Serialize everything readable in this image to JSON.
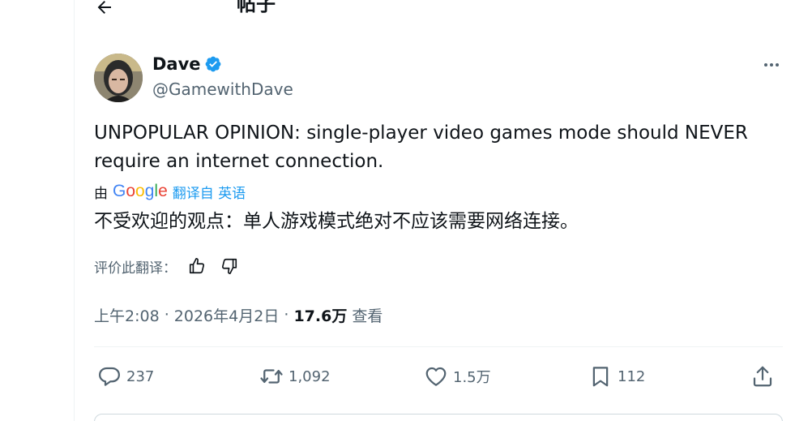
{
  "header": {
    "title": "帖子"
  },
  "author": {
    "display_name": "Dave",
    "handle": "@GamewithDave"
  },
  "tweet": {
    "text": "UNPOPULAR OPINION: single-player video games mode should NEVER require an internet connection.",
    "translated_by_label": "由",
    "google_letters": [
      "G",
      "o",
      "o",
      "g",
      "l",
      "e"
    ],
    "google_colors": [
      "#4285f4",
      "#ea4335",
      "#fbbc05",
      "#4285f4",
      "#34a853",
      "#ea4335"
    ],
    "translate_link": "翻译自 英语",
    "translated_text": "不受欢迎的观点：单人游戏模式绝对不应该需要网络连接。",
    "rate_label": "评价此翻译："
  },
  "meta": {
    "time": "上午2:08",
    "sep1": " · ",
    "date": "2026年4月2日",
    "sep2": " · ",
    "views": "17.6万",
    "views_label": " 查看"
  },
  "actions": {
    "replies": "237",
    "reposts": "1,092",
    "likes": "1.5万",
    "bookmarks": "112"
  },
  "colors": {
    "accent": "#1d9bf0",
    "muted": "#536471",
    "text": "#0f1419"
  },
  "icons": [
    "back-arrow-icon",
    "verified-badge-icon",
    "more-icon",
    "thumbs-up-icon",
    "thumbs-down-icon",
    "reply-icon",
    "repost-icon",
    "like-icon",
    "bookmark-icon",
    "share-icon"
  ]
}
